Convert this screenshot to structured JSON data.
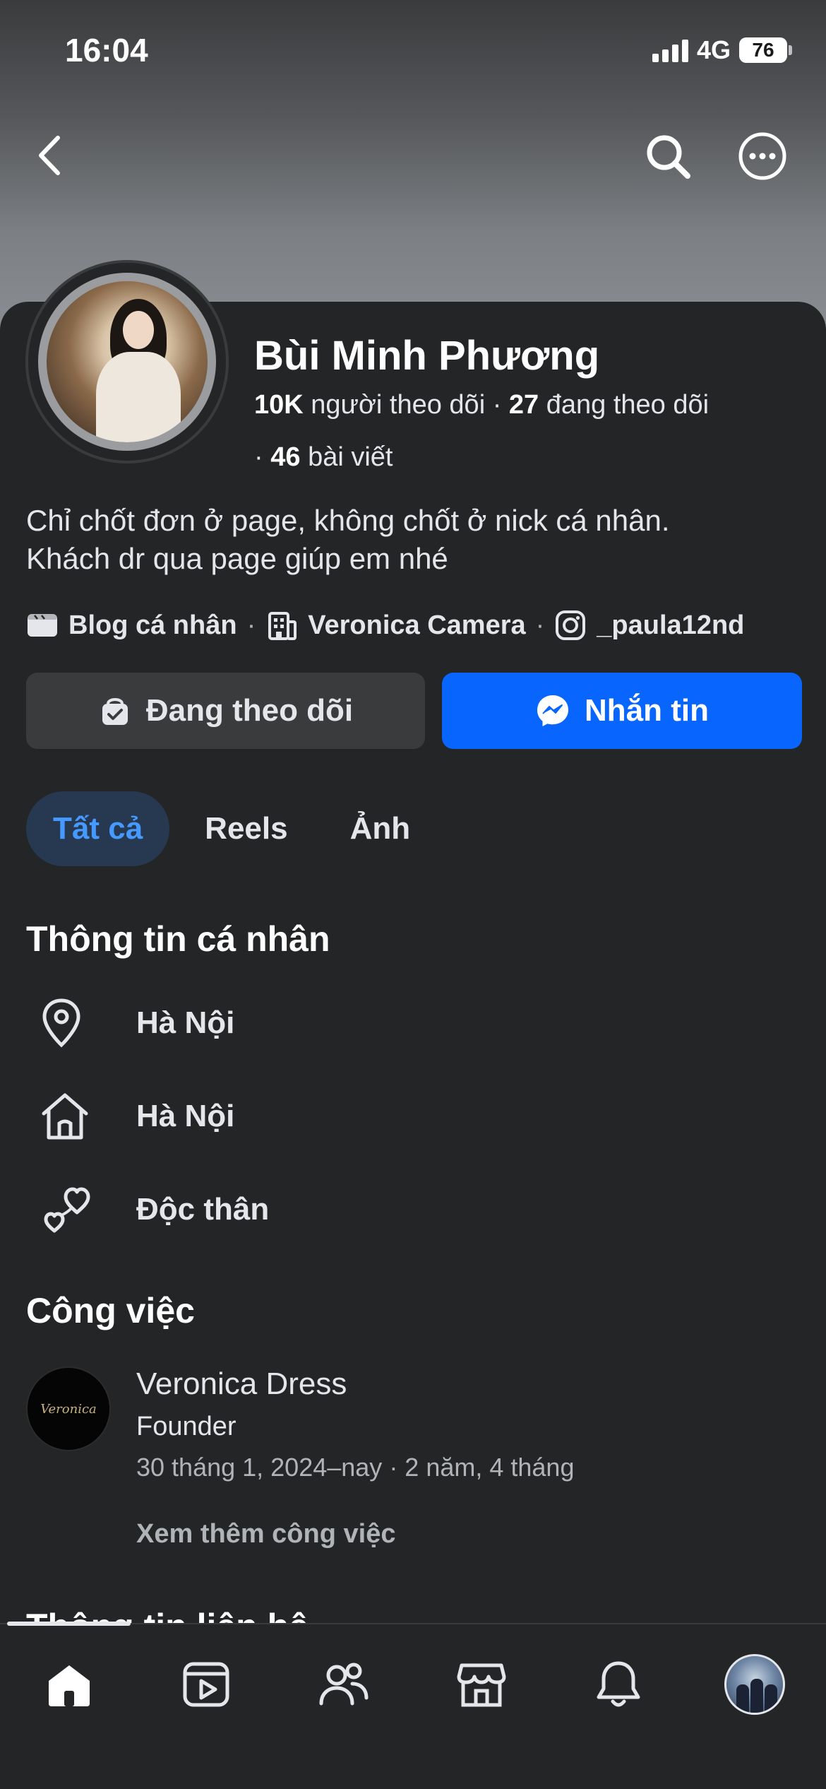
{
  "status_bar": {
    "time": "16:04",
    "network": "4G",
    "battery": "76"
  },
  "profile": {
    "name": "Bùi Minh Phương",
    "followers_count": "10K",
    "followers_label": "người theo dõi",
    "following_count": "27",
    "following_label": "đang theo dõi",
    "posts_count": "46",
    "posts_label": "bài viết",
    "bio_line1": "Chỉ chốt đơn ở page, không chốt ở nick cá nhân.",
    "bio_line2": "Khách dr qua page giúp em nhé",
    "links": [
      {
        "label": "Blog cá nhân",
        "icon": "blog-icon"
      },
      {
        "label": "Veronica Camera",
        "icon": "building-icon"
      },
      {
        "label": "_paula12nd",
        "icon": "instagram-icon"
      }
    ]
  },
  "actions": {
    "follow_label": "Đang theo dõi",
    "message_label": "Nhắn tin"
  },
  "tabs": [
    {
      "label": "Tất cả",
      "active": true
    },
    {
      "label": "Reels",
      "active": false
    },
    {
      "label": "Ảnh",
      "active": false
    }
  ],
  "personal_info": {
    "title": "Thông tin cá nhân",
    "items": [
      {
        "label": "Hà Nội",
        "icon": "location-pin-icon"
      },
      {
        "label": "Hà Nội",
        "icon": "home-icon"
      },
      {
        "label": "Độc thân",
        "icon": "hearts-icon"
      }
    ]
  },
  "work": {
    "title": "Công việc",
    "company": "Veronica Dress",
    "role": "Founder",
    "dates": "30 tháng 1, 2024–nay · 2 năm, 4 tháng",
    "see_more": "Xem thêm công việc"
  },
  "contact": {
    "title": "Thông tin liên hệ"
  },
  "colors": {
    "background": "#242526",
    "accent": "#0866ff",
    "tab_active_bg": "#263951",
    "tab_active_text": "#4599ff"
  },
  "bottom_nav": [
    "home-icon",
    "video-icon",
    "friends-icon",
    "marketplace-icon",
    "bell-icon",
    "profile-avatar"
  ]
}
